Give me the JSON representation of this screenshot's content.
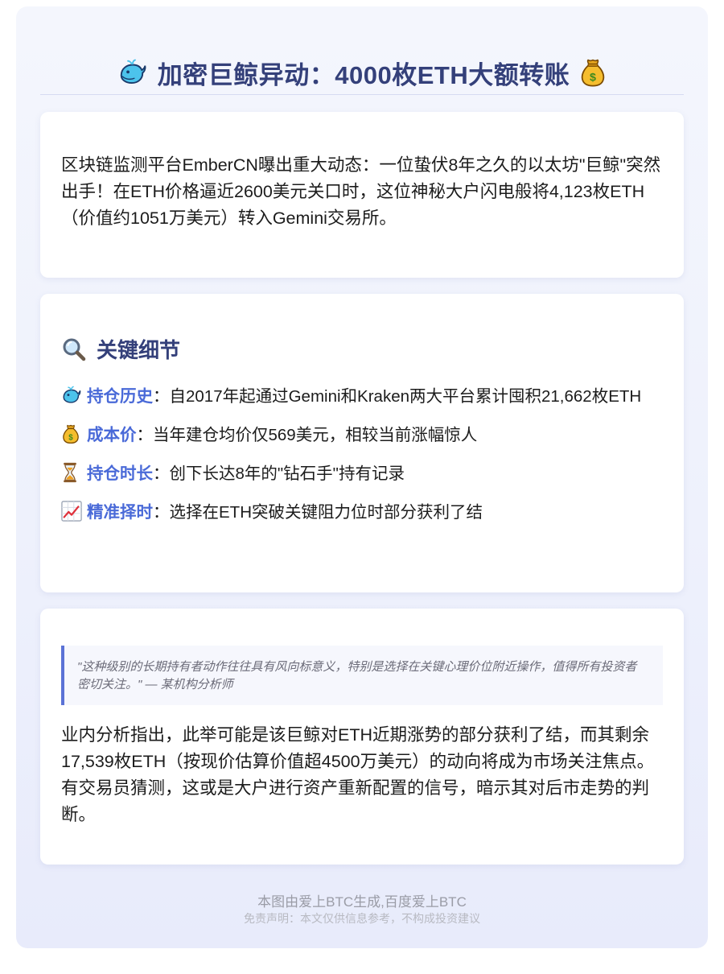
{
  "title": {
    "text": "加密巨鲸异动：4000枚ETH大额转账",
    "lead_icon": "whale-icon",
    "trail_icon": "money-bag-icon"
  },
  "intro": {
    "text": "区块链监测平台EmberCN曝出重大动态：一位蛰伏8年之久的以太坊\"巨鲸\"突然出手！在ETH价格逼近2600美元关口时，这位神秘大户闪电般将4,123枚ETH（价值约1051万美元）转入Gemini交易所。"
  },
  "details": {
    "heading": "关键细节",
    "heading_icon": "magnifier-icon",
    "items": [
      {
        "icon": "whale-icon",
        "label": "持仓历史",
        "text": "：自2017年起通过Gemini和Kraken两大平台累计囤积21,662枚ETH"
      },
      {
        "icon": "money-bag-icon",
        "label": "成本价",
        "text": "：当年建仓均价仅569美元，相较当前涨幅惊人"
      },
      {
        "icon": "hourglass-icon",
        "label": "持仓时长",
        "text": "：创下长达8年的\"钻石手\"持有记录"
      },
      {
        "icon": "chart-up-icon",
        "label": "精准择时",
        "text": "：选择在ETH突破关键阻力位时部分获利了结"
      }
    ]
  },
  "analysis": {
    "quote": "\"这种级别的长期持有者动作往往具有风向标意义，特别是选择在关键心理价位附近操作，值得所有投资者密切关注。\" — 某机构分析师",
    "text": "业内分析指出，此举可能是该巨鲸对ETH近期涨势的部分获利了结，而其剩余17,539枚ETH（按现价估算价值超4500万美元）的动向将成为市场关注焦点。有交易员猜测，这或是大户进行资产重新配置的信号，暗示其对后市走势的判断。"
  },
  "footer": {
    "source": "本图由爱上BTC生成,百度爱上BTC",
    "disclaimer": "免责声明：本文仅供信息参考，不构成投资建议"
  },
  "colors": {
    "accent": "#4a6ad8",
    "heading": "#34407a",
    "quote_bar": "#5b72d6"
  }
}
